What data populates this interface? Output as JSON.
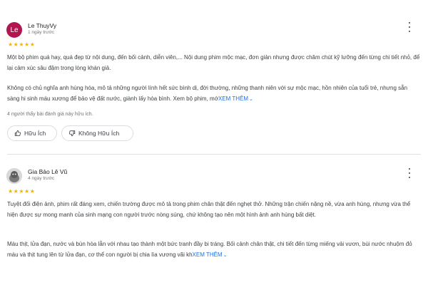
{
  "reviews": [
    {
      "avatar_text": "Le",
      "author": "Le ThuyVy",
      "time": "1 ngày trước",
      "stars": "★★★★★",
      "paragraphs": [
        "Một bộ phim quá hay, quá đẹp từ nội dung, đến bối cảnh, diễn viên,... Nội dung phim mộc mạc, đơn giản nhưng được chăm chút kỹ lưỡng đến từng chi tiết nhỏ, để lại cảm xúc sâu đậm trong lòng khán giả.",
        "Không có chủ nghĩa anh hùng hóa, mô tả những người lính hết sức bình dị, đời thường, những thanh niên với sự mộc mạc, hồn nhiên của tuổi trẻ, nhưng sẵn sàng hi sinh máu xương để bảo vệ đất nước, giành lấy hòa bình. Xem bộ phim, mớ"
      ],
      "see_more": "XEM THÊM",
      "helpful_count": "4 người thấy bài đánh giá này hữu ích.",
      "helpful_label": "Hữu Ích",
      "not_helpful_label": "Không Hữu Ích"
    },
    {
      "avatar_text": "",
      "author": "Gia Bảo Lê Vũ",
      "time": "4 ngày trước",
      "stars": "★★★★★",
      "paragraphs": [
        "Tuyệt đối điện ảnh, phim rất đáng xem, chiến trường được mô tả trong phim chân thật đến nghẹt thở. Những trận chiến nặng nề, vừa anh hùng, nhưng vừa thể hiện được sự mong manh của sinh mạng con người trước nòng súng, chứ không tạo nên một hình ảnh anh hùng bất diệt.",
        "Máu thịt, lửa đạn, nước và bùn hòa lẫn với nhau tạo thành một bức tranh đầy bi tráng. Bối cảnh chân thật, chi tiết đến từng miếng vải vươn, bùi nước nhuộm đỏ máu và thịt tung lên từ lửa đạn, cơ thể con người bị chia lìa vương vãi kh"
      ],
      "see_more": "XEM THÊM"
    }
  ],
  "icons": {
    "star": "star-icon",
    "more": "more-vert-icon",
    "thumb_up": "thumb-up-icon",
    "thumb_down": "thumb-down-icon",
    "chevron": "chevron-down-icon"
  },
  "colors": {
    "star": "#f4b400",
    "link": "#1a73e8",
    "avatar1": "#b0174f"
  }
}
